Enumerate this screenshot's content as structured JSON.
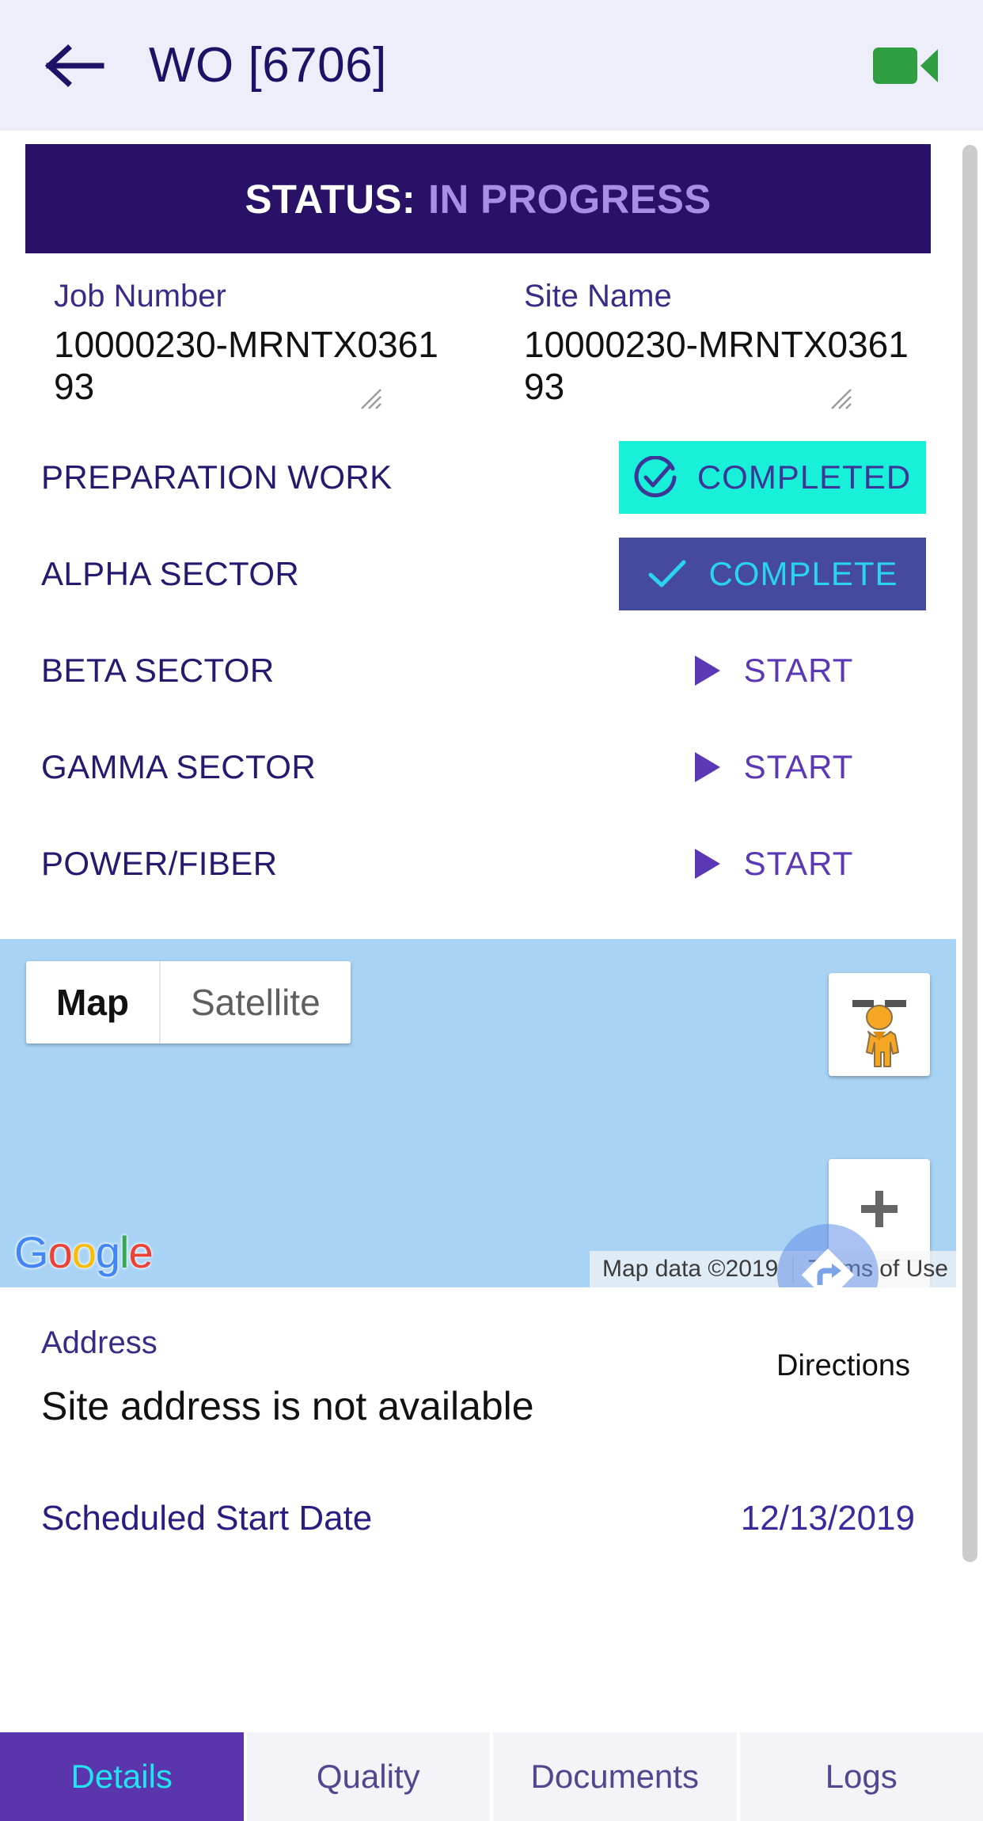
{
  "header": {
    "back_icon": "back-arrow-icon",
    "title": "WO [6706]",
    "video_icon": "video-camera-icon",
    "video_color": "#2e9e40",
    "background": "#eeeefa",
    "title_color": "#1c1266"
  },
  "status_banner": {
    "label": "STATUS:",
    "value": "IN PROGRESS",
    "background": "#2a1168",
    "label_color": "#ffffff",
    "value_color": "#a98ee8"
  },
  "fields": [
    {
      "label": "Job Number",
      "value": "10000230-MRNTX036193"
    },
    {
      "label": "Site Name",
      "value": "10000230-MRNTX036193"
    }
  ],
  "tasks": [
    {
      "label": "PREPARATION WORK",
      "action": "COMPLETED",
      "state": "completed",
      "icon": "check-circle-icon"
    },
    {
      "label": "ALPHA SECTOR",
      "action": "COMPLETE",
      "state": "complete",
      "icon": "check-icon"
    },
    {
      "label": "BETA SECTOR",
      "action": "START",
      "state": "start",
      "icon": "play-icon"
    },
    {
      "label": "GAMMA SECTOR",
      "action": "START",
      "state": "start",
      "icon": "play-icon"
    },
    {
      "label": "POWER/FIBER",
      "action": "START",
      "state": "start",
      "icon": "play-icon"
    }
  ],
  "task_colors": {
    "completed_bg": "#19f0da",
    "completed_text": "#3c3796",
    "complete_bg": "#464a9e",
    "complete_text": "#2ad4ee",
    "start_text": "#5b38b5",
    "label_color": "#251a6e"
  },
  "map": {
    "type_map_label": "Map",
    "type_satellite_label": "Satellite",
    "selected_type": "Map",
    "pegman_icon": "street-view-pegman-icon",
    "zoom_in_icon": "plus-icon",
    "zoom_out_icon": "minus-icon",
    "logo_letters": [
      "G",
      "o",
      "o",
      "g",
      "l",
      "e"
    ],
    "logo_colors": [
      "#4285f4",
      "#ea4335",
      "#fbbc05",
      "#4285f4",
      "#34a853",
      "#ea4335"
    ],
    "attribution": "Map data ©2019",
    "terms": "Terms of Use",
    "background": "#a8d3f5"
  },
  "directions": {
    "label": "Directions",
    "icon": "directions-turn-right-icon"
  },
  "address": {
    "label": "Address",
    "value": "Site address is not available"
  },
  "schedule": {
    "label": "Scheduled Start Date",
    "value": "12/13/2019"
  },
  "tabs": [
    {
      "label": "Details",
      "active": true
    },
    {
      "label": "Quality",
      "active": false
    },
    {
      "label": "Documents",
      "active": false
    },
    {
      "label": "Logs",
      "active": false
    }
  ],
  "tab_colors": {
    "active_bg": "#5b35ac",
    "active_text": "#22e3f0",
    "inactive_bg": "#f3f3f8",
    "inactive_text": "#51478f"
  }
}
